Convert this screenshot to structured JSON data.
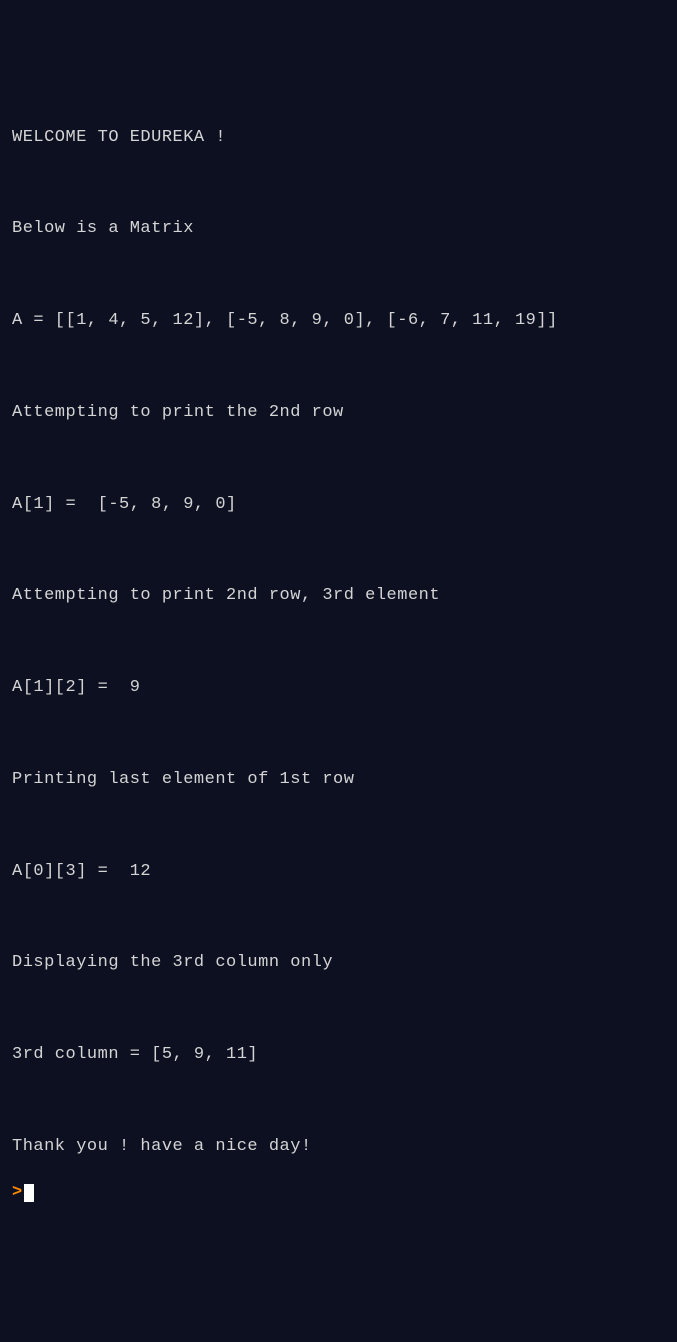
{
  "terminal": {
    "lines": [
      "WELCOME TO EDUREKA !",
      "",
      "Below is a Matrix",
      "",
      "A = [[1, 4, 5, 12], [-5, 8, 9, 0], [-6, 7, 11, 19]]",
      "",
      "Attempting to print the 2nd row",
      "",
      "A[1] =  [-5, 8, 9, 0]",
      "",
      "Attempting to print 2nd row, 3rd element",
      "",
      "A[1][2] =  9",
      "",
      "Printing last element of 1st row",
      "",
      "A[0][3] =  12",
      "",
      "Displaying the 3rd column only",
      "",
      "3rd column = [5, 9, 11]",
      "",
      "Thank you ! have a nice day!"
    ],
    "prompt": ">"
  }
}
